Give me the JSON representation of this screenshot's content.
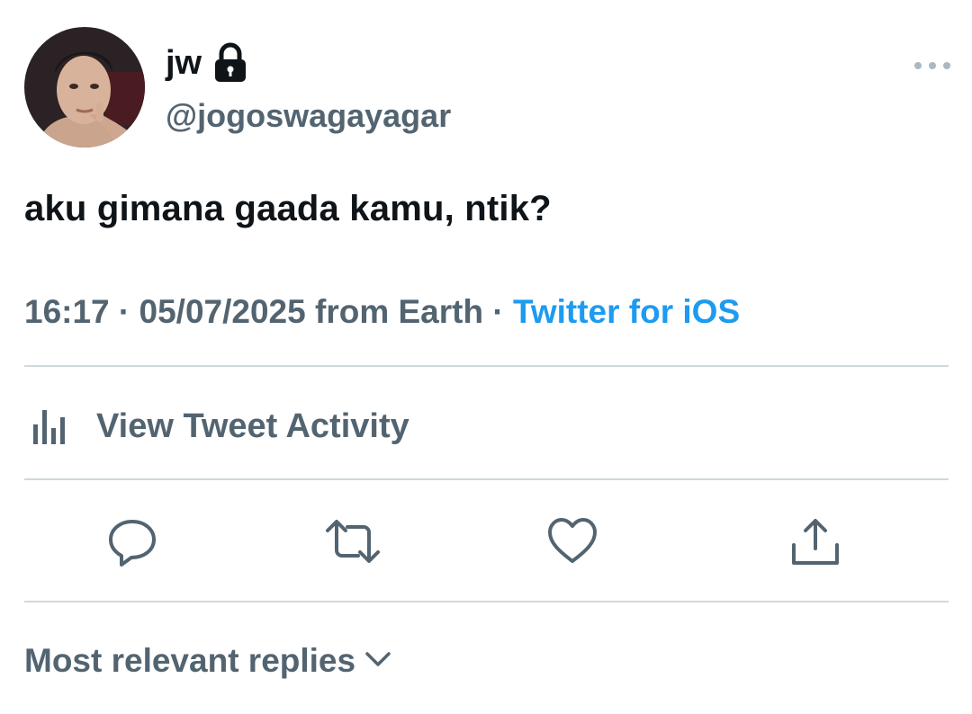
{
  "user": {
    "display_name": "jw",
    "handle": "@jogoswagayagar",
    "protected_icon": "lock-icon",
    "avatar": "avatar-photo"
  },
  "tweet": {
    "text": "aku gimana gaada kamu, ntik?"
  },
  "meta": {
    "time": "16:17",
    "separator": " · ",
    "date_location": "05/07/2025 from Earth",
    "source": "Twitter for iOS"
  },
  "activity": {
    "icon": "bar-chart-icon",
    "label": "View Tweet Activity"
  },
  "actions": [
    {
      "name": "reply",
      "icon": "reply-icon"
    },
    {
      "name": "retweet",
      "icon": "retweet-icon"
    },
    {
      "name": "like",
      "icon": "heart-icon"
    },
    {
      "name": "share",
      "icon": "share-icon"
    }
  ],
  "replies": {
    "label": "Most relevant replies",
    "icon": "chevron-down-icon"
  },
  "colors": {
    "text_primary": "#0f1419",
    "text_secondary": "#536471",
    "link": "#1d9bf0",
    "divider": "#cfd9de"
  }
}
